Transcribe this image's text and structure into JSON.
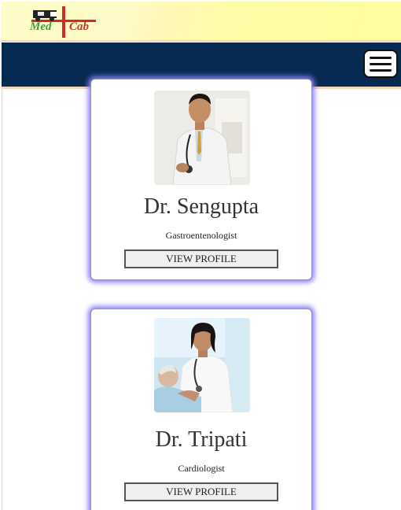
{
  "brand": {
    "logo_text_left": "Med",
    "logo_text_right": "Cab"
  },
  "navbar": {
    "menu_icon": "hamburger-menu-icon",
    "background": "#072a52"
  },
  "doctors": [
    {
      "name": "Dr. Sengupta",
      "specialty": "Gastroentenologist",
      "button_label": "VIEW PROFILE",
      "photo": "doctor-portrait"
    },
    {
      "name": "Dr. Tripati",
      "specialty": "Cardiologist",
      "button_label": "VIEW PROFILE",
      "photo": "doctor-with-patient"
    }
  ],
  "colors": {
    "card_glow": "#8a7df6",
    "nav_accent": "#f3d5b8",
    "logo_green": "#3da33a",
    "logo_red": "#c23a2a"
  }
}
